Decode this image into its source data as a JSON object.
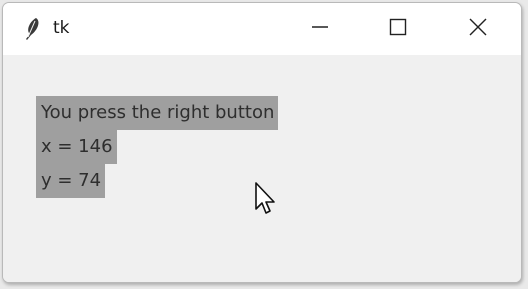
{
  "window": {
    "title": "tk",
    "icon": "feather-icon",
    "controls": [
      "minimize-icon",
      "maximize-icon",
      "close-icon"
    ]
  },
  "message": {
    "line1": "You press the right button",
    "line2": "x = 146",
    "line3": "y = 74"
  },
  "colors": {
    "label_background": "#9f9f9f",
    "label_text": "#2e2e2e",
    "window_background": "#f0f0f0"
  }
}
